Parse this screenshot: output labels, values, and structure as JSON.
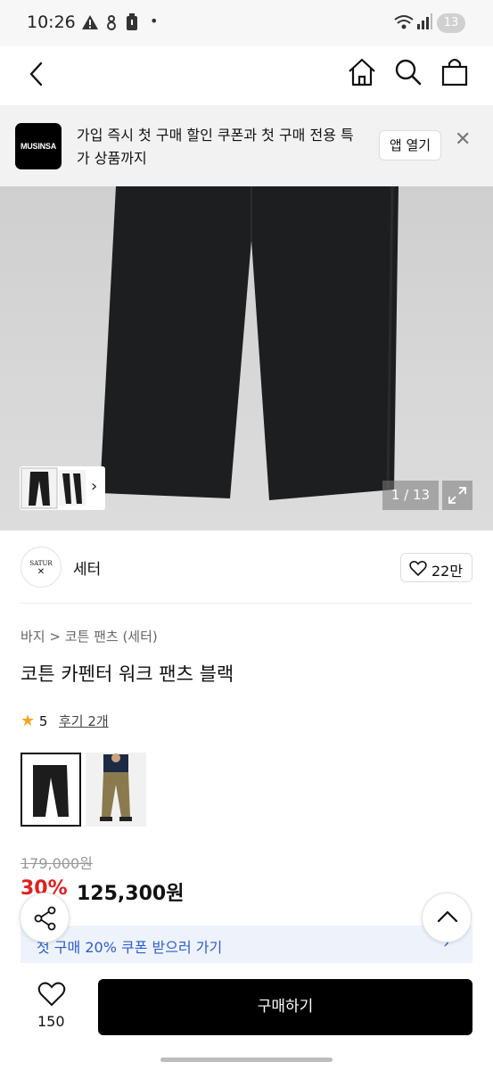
{
  "status_bar": {
    "time": "10:26",
    "dot": "•",
    "battery_level": "13",
    "icons": [
      "warning-icon",
      "vpn-icon",
      "battery-saver-icon",
      "wifi-icon",
      "signal-icon"
    ]
  },
  "header": {
    "icons": [
      "back-arrow-icon",
      "home-icon",
      "search-icon",
      "shopping-bag-icon"
    ]
  },
  "banner": {
    "logo": "MUSINSA",
    "text": "가입 즉시 첫 구매 할인 쿠폰과 첫 구매 전용 특가 상품까지",
    "open_app": "앱 열기",
    "close": "✕"
  },
  "hero": {
    "counter": "1 / 13",
    "thumb_arrow": "›"
  },
  "brand": {
    "logo_text": "SATUR",
    "name": "세터",
    "likes": "22만"
  },
  "product": {
    "breadcrumb": "바지 > 코튼 팬츠 (세터)",
    "title": "코튼 카펜터 워크 팬츠 블랙",
    "rating": "5",
    "reviews": "후기 2개",
    "original_price": "179,000원",
    "discount": "30%",
    "price": "125,300원",
    "coupon": "첫 구매 20% 쿠폰 받으러 가기",
    "coupon_arrow": "›"
  },
  "bottom_bar": {
    "wish_count": "150",
    "buy_label": "구매하기"
  },
  "colors": {
    "accent_red": "#e02020",
    "coupon_blue": "#2a5cd1",
    "buy_button": "#000000"
  }
}
